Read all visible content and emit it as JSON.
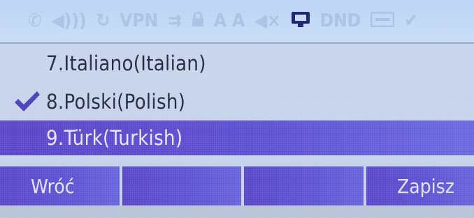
{
  "status_bar": {
    "icons": [
      {
        "icon": "phone-icon",
        "glyph": "✆",
        "active": false
      },
      {
        "icon": "speaker-volume-icon",
        "glyph": "◀)))",
        "active": false
      },
      {
        "icon": "refresh-icon",
        "glyph": "↻",
        "active": false
      },
      {
        "icon": "vpn-icon",
        "label": "VPN",
        "active": false
      },
      {
        "icon": "call-forward-icon",
        "glyph": "⇉",
        "active": false
      },
      {
        "icon": "lock-icon",
        "glyph": "🔒",
        "active": false
      },
      {
        "icon": "auto-answer-icon",
        "label": "A A",
        "active": false
      },
      {
        "icon": "mute-icon",
        "glyph": "◀×",
        "active": false
      },
      {
        "icon": "network-icon",
        "glyph": "▣",
        "active": true
      },
      {
        "icon": "dnd-icon",
        "label": "DND",
        "active": false
      },
      {
        "icon": "voicemail-icon",
        "glyph": "▭",
        "active": false
      },
      {
        "icon": "check-icon",
        "glyph": "✔",
        "active": false
      }
    ]
  },
  "languages": [
    {
      "label": "7.Italiano(Italian)",
      "checked": false,
      "highlighted": false
    },
    {
      "label": "8.Polski(Polish)",
      "checked": true,
      "highlighted": false
    },
    {
      "label": "9.Türk(Turkish)",
      "checked": false,
      "highlighted": true
    }
  ],
  "softkeys": {
    "back_label": "Wróć",
    "key2_label": "",
    "key3_label": "",
    "save_label": "Zapisz"
  },
  "colors": {
    "highlight": "#5d4fd2",
    "screen_bg": "#c6d3ea",
    "status_active": "#1a1f6e"
  }
}
